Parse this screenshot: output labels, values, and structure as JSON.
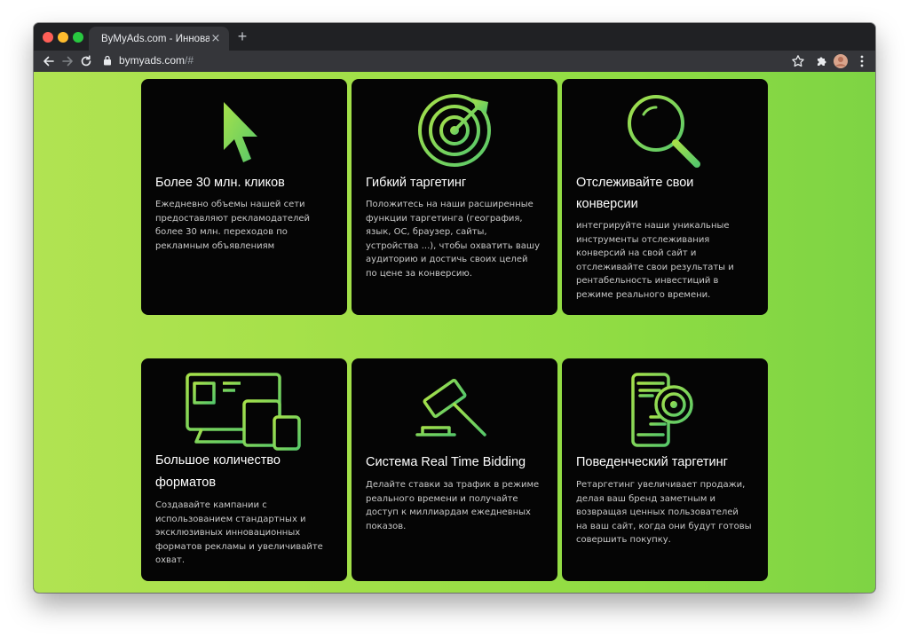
{
  "browser": {
    "tab_title": "ByMyAds.com - Инновационные",
    "tab_close": "×",
    "new_tab": "+",
    "url_host": "bymyads.com",
    "url_rest": "/#"
  },
  "colors": {
    "accent_green": "#8fdc43",
    "card_bg": "#050505",
    "icon_gradient": [
      "#a6e14a",
      "#57c86a"
    ]
  },
  "cards": [
    {
      "icon": "cursor-icon",
      "title": "Более 30 млн. кликов",
      "text": "Ежедневно объемы нашей сети предоставляют рекламодателей более 30 млн. переходов по рекламным объявлениям"
    },
    {
      "icon": "target-icon",
      "title": "Гибкий таргетинг",
      "text": "Положитесь на наши расширенные функции таргетинга (география, язык, ОС, браузер, сайты, устройства ...), чтобы охватить вашу аудиторию и достичь своих целей по цене за конверсию."
    },
    {
      "icon": "magnifier-icon",
      "title": "Отслеживайте свои конверсии",
      "text": "интегрируйте наши уникальные инструменты отслеживания конверсий на свой сайт и отслеживайте свои результаты и рентабельность инвестиций в режиме реального времени."
    },
    {
      "icon": "devices-icon",
      "title": "Большое количество форматов",
      "text": "Создавайте кампании с использованием стандартных и эксклюзивных инновационных форматов рекламы и увеличивайте охват."
    },
    {
      "icon": "gavel-icon",
      "title": "Система Real Time Bidding",
      "text": "Делайте ставки за трафик в режиме реального времени и получайте доступ к миллиардам ежедневных показов."
    },
    {
      "icon": "phone-target-icon",
      "title": "Поведенческий таргетинг",
      "text": "Ретаргетинг увеличивает продажи, делая ваш бренд заметным и возвращая ценных пользователей на ваш сайт, когда они будут готовы совершить покупку."
    }
  ]
}
